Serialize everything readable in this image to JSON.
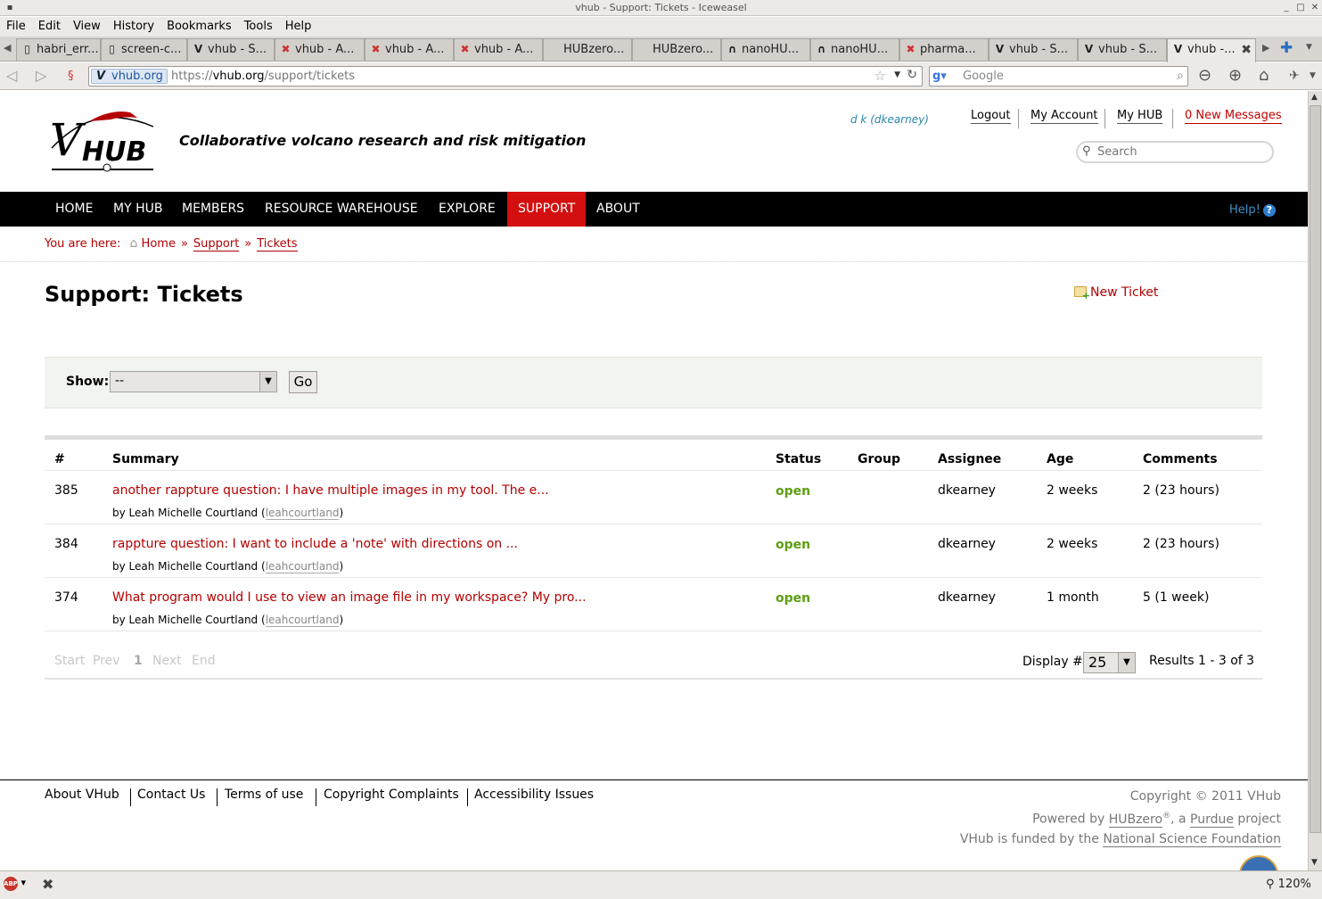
{
  "window": {
    "title": "vhub - Support: Tickets - Iceweasel"
  },
  "menu": [
    "File",
    "Edit",
    "View",
    "History",
    "Bookmarks",
    "Tools",
    "Help"
  ],
  "tabs": [
    {
      "label": "habri_err...",
      "icon": "document-icon"
    },
    {
      "label": "screen-c...",
      "icon": "document-icon"
    },
    {
      "label": "vhub - S...",
      "icon": "vhub-icon"
    },
    {
      "label": "vhub - A...",
      "icon": "hubzero-icon"
    },
    {
      "label": "vhub - A...",
      "icon": "hubzero-icon"
    },
    {
      "label": "vhub - A...",
      "icon": "hubzero-icon"
    },
    {
      "label": "HUBzero...",
      "icon": "none"
    },
    {
      "label": "HUBzero...",
      "icon": "none"
    },
    {
      "label": "nanoHU...",
      "icon": "nanohub-icon"
    },
    {
      "label": "nanoHU...",
      "icon": "nanohub-icon"
    },
    {
      "label": "pharma...",
      "icon": "hubzero-icon"
    },
    {
      "label": "vhub - S...",
      "icon": "vhub-icon"
    },
    {
      "label": "vhub - S...",
      "icon": "vhub-icon"
    },
    {
      "label": "vhub -...",
      "icon": "vhub-icon",
      "active": true
    }
  ],
  "nav": {
    "site_badge": "vhub.org",
    "url_scheme": "https://",
    "url_host": "vhub.org",
    "url_path": "/support/tickets",
    "search_placeholder": "Google",
    "zoom": "120%"
  },
  "site": {
    "tagline": "Collaborative volcano research and risk mitigation",
    "user": "d k (dkearney)",
    "toplinks": {
      "logout": "Logout",
      "account": "My Account",
      "myhub": "My HUB",
      "messages": "0 New Messages"
    },
    "search_placeholder": "Search",
    "mainnav": [
      "HOME",
      "MY HUB",
      "MEMBERS",
      "RESOURCE WAREHOUSE",
      "EXPLORE",
      "SUPPORT",
      "ABOUT"
    ],
    "mainnav_active": "SUPPORT",
    "help": "Help!"
  },
  "breadcrumb": {
    "label": "You are here:",
    "items": [
      "Home",
      "Support",
      "Tickets"
    ]
  },
  "page": {
    "title": "Support: Tickets",
    "new_ticket": "New Ticket"
  },
  "filter": {
    "label": "Show:",
    "selected": "--",
    "go": "Go"
  },
  "table": {
    "headers": [
      "#",
      "Summary",
      "Status",
      "Group",
      "Assignee",
      "Age",
      "Comments"
    ],
    "rows": [
      {
        "num": "385",
        "summary": "another rappture question: I have multiple images in my tool. The e...",
        "by": "by Leah Michelle Courtland",
        "username": "leahcourtland",
        "status": "open",
        "group": "",
        "assignee": "dkearney",
        "age": "2 weeks",
        "comments": "2 (23 hours)"
      },
      {
        "num": "384",
        "summary": "rappture question: I want to include a 'note' with directions on ...",
        "by": "by Leah Michelle Courtland",
        "username": "leahcourtland",
        "status": "open",
        "group": "",
        "assignee": "dkearney",
        "age": "2 weeks",
        "comments": "2 (23 hours)"
      },
      {
        "num": "374",
        "summary": "What program would I use to view an image file in my workspace? My pro...",
        "by": "by Leah Michelle Courtland",
        "username": "leahcourtland",
        "status": "open",
        "group": "",
        "assignee": "dkearney",
        "age": "1 month",
        "comments": "5 (1 week)"
      }
    ]
  },
  "pager": {
    "start": "Start",
    "prev": "Prev",
    "current": "1",
    "next": "Next",
    "end": "End",
    "display_label": "Display #",
    "display_value": "25",
    "results": "Results 1 - 3 of 3"
  },
  "footer": {
    "links": [
      "About VHub",
      "Contact Us",
      "Terms of use",
      "Copyright Complaints",
      "Accessibility Issues"
    ],
    "copyright": "Copyright © 2011 VHub",
    "powered_pre": "Powered by ",
    "powered_hub": "HUBzero",
    "powered_reg": "®",
    "powered_mid": ", a ",
    "powered_purdue": "Purdue",
    "powered_post": " project",
    "funded_pre": "VHub is funded by the ",
    "funded_nsf": "National Science Foundation"
  },
  "colors": {
    "accent_red": "#b30000",
    "nav_active": "#d40f0f",
    "status_open": "#5d9e10"
  }
}
